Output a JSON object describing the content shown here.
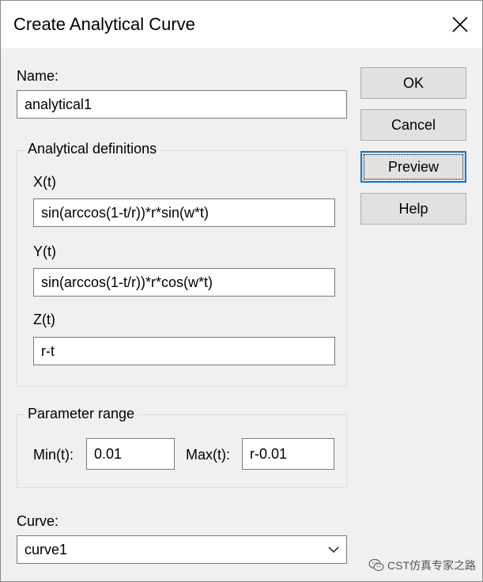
{
  "window": {
    "title": "Create Analytical Curve"
  },
  "name_field": {
    "label": "Name:",
    "value": "analytical1"
  },
  "definitions": {
    "legend": "Analytical definitions",
    "x": {
      "label": "X(t)",
      "value": "sin(arccos(1-t/r))*r*sin(w*t)"
    },
    "y": {
      "label": "Y(t)",
      "value": "sin(arccos(1-t/r))*r*cos(w*t)"
    },
    "z": {
      "label": "Z(t)",
      "value": "r-t"
    }
  },
  "parameter_range": {
    "legend": "Parameter range",
    "min": {
      "label": "Min(t):",
      "value": "0.01"
    },
    "max": {
      "label": "Max(t):",
      "value": "r-0.01"
    }
  },
  "curve": {
    "label": "Curve:",
    "selected": "curve1"
  },
  "buttons": {
    "ok": "OK",
    "cancel": "Cancel",
    "preview": "Preview",
    "help": "Help"
  },
  "watermark": {
    "text": "CST仿真专家之路",
    "icon": "wechat-icon"
  },
  "colors": {
    "focus": "#0078d7",
    "button_face": "#e1e1e1",
    "dialog_bg": "#f0f0f0"
  }
}
